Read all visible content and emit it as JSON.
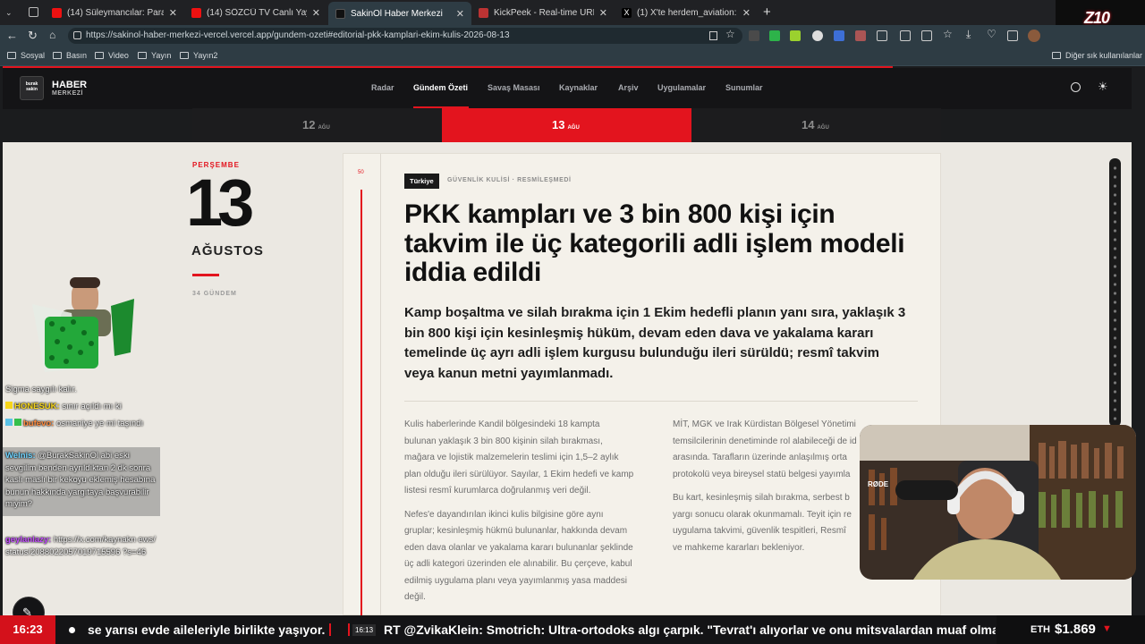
{
  "browser": {
    "tabs": [
      {
        "title": "(14) Süleymancılar: Para Kaçakçılığ",
        "fav": "#e11"
      },
      {
        "title": "(14) SÖZCÜ TV Canlı Yayını ᴴᴰ - Yo",
        "fav": "#e11"
      },
      {
        "title": "SakinOl Haber Merkezi",
        "fav": "#222"
      },
      {
        "title": "KickPeek - Real-time URL Crawler",
        "fav": "#d33"
      },
      {
        "title": "(1) X'te herdem_aviation: \"Yalova'c",
        "fav": "#000"
      }
    ],
    "url": "https://sakinol-haber-merkezi-vercel.vercel.app/gundem-ozeti#editorial-pkk-kamplari-ekim-kulis-2026-08-13",
    "bookmarks": [
      "Sosyal",
      "Basın",
      "Video",
      "Yayın",
      "Yayın2"
    ],
    "other_bookmarks": "Diğer sık kullanılanlar"
  },
  "site": {
    "logo_small": "burak sakin",
    "logo_line1": "HABER",
    "logo_line2": "MERKEZİ",
    "nav": [
      "Radar",
      "Gündem Özeti",
      "Savaş Masası",
      "Kaynaklar",
      "Arşiv",
      "Uygulamalar",
      "Sunumlar"
    ],
    "active_nav": "Gündem Özeti"
  },
  "dates": [
    {
      "day": "12",
      "mon": "AĞU"
    },
    {
      "day": "13",
      "mon": "AĞU"
    },
    {
      "day": "14",
      "mon": "AĞU"
    }
  ],
  "sidebar": {
    "weekday": "PERŞEMBE",
    "day": "13",
    "month": "AĞUSTOS",
    "count": "34 GÜNDEM"
  },
  "article": {
    "rank": "50",
    "tag": "Türkiye",
    "category": "GÜVENLİK KULİSİ · RESMİLEŞMEDİ",
    "title_lines": [
      "PKK kampları ve 3 bin 800 kişi için",
      "takvim ile üç kategorili adli işlem modeli",
      "iddia edildi"
    ],
    "lead_lines": [
      "Kamp boşaltma ve silah bırakma için 1 Ekim hedefli planın yanı sıra, yaklaşık 3",
      "bin 800 kişi için kesinleşmiş hüküm, devam eden dava ve yakalama kararı",
      "temelinde üç ayrı adli işlem kurgusu bulunduğu ileri sürüldü; resmî takvim",
      "veya kanun metni yayımlanmadı."
    ],
    "col1_p1": [
      "Kulis haberlerinde Kandil bölgesindeki 18 kampta",
      "bulunan yaklaşık 3 bin 800 kişinin silah bırakması,",
      "mağara ve lojistik malzemelerin teslimi için 1,5–2 aylık",
      "plan olduğu ileri sürülüyor. Sayılar, 1 Ekim hedefi ve kamp",
      "listesi resmî kurumlarca doğrulanmış veri değil."
    ],
    "col1_p2": [
      "Nefes'e dayandırılan ikinci kulis bilgisine göre aynı",
      "gruplar; kesinleşmiş hükmü bulunanlar, hakkında devam",
      "eden dava olanlar ve yakalama kararı bulunanlar şeklinde",
      "üç adli kategori üzerinden ele alınabilir. Bu çerçeve, kabul",
      "edilmiş uygulama planı veya yayımlanmış yasa maddesi",
      "değil."
    ],
    "col2_p1": [
      "MİT, MGK ve Irak Kürdistan Bölgesel Yönetimi",
      "temsilcilerinin denetiminde rol alabileceği de id",
      "arasında. Tarafların üzerinde anlaşılmış orta",
      "protokolü veya bireysel statü belgesi yayımla"
    ],
    "col2_p2": [
      "Bu kart, kesinleşmiş silah bırakma, serbest b",
      "yargı sonucu olarak okunmamalı. Teyit için re",
      "uygulama takvimi, güvenlik tespitleri, Resmî",
      "ve mahkeme kararları bekleniyor."
    ]
  },
  "chat": [
    {
      "user": "",
      "text": "Sigma saygılı kalır.",
      "color": "#fff"
    },
    {
      "user": "HONESUK:",
      "text": "sınır açıldı mı ki",
      "color": "#f6d51a"
    },
    {
      "user": "bufevo:",
      "text": "osmaniye ye mi taşındı",
      "color": "#ff8a3d"
    },
    {
      "user": "Welnis:",
      "text": "@BurakSakinOl abi eski sevgilim benden ayrıldıktan 2 dk sonra kaslı maslı bir kekoyu eklemiş hesabına bunun hakkında yargıtaya başvurabilir miyim?",
      "color": "#6fd4ff"
    },
    {
      "user": "geylanlazy:",
      "text": "https://x.com/kaynakn ews/status/2088022057019715596 ?s=46",
      "color": "#c44dff"
    }
  ],
  "stream": {
    "channel_logo": "Z10",
    "clock": "16:23",
    "ticker_left": "se yarısı evde aileleriyle birlikte yaşıyor.",
    "ticker_time": "16:13",
    "ticker_right": "RT @ZvikaKlein: Smotrich: Ultra-ortodoks algı çarpık. \"Tevrat'ı alıyorlar ve onu mitsvalardan muaf olmak i",
    "crypto_label": "ETH",
    "crypto_value": "$1.869",
    "crypto_dir": "▼",
    "mic_brand": "RØDE"
  },
  "colors": {
    "accent": "#e3141e",
    "chrome": "#2e3c44"
  }
}
